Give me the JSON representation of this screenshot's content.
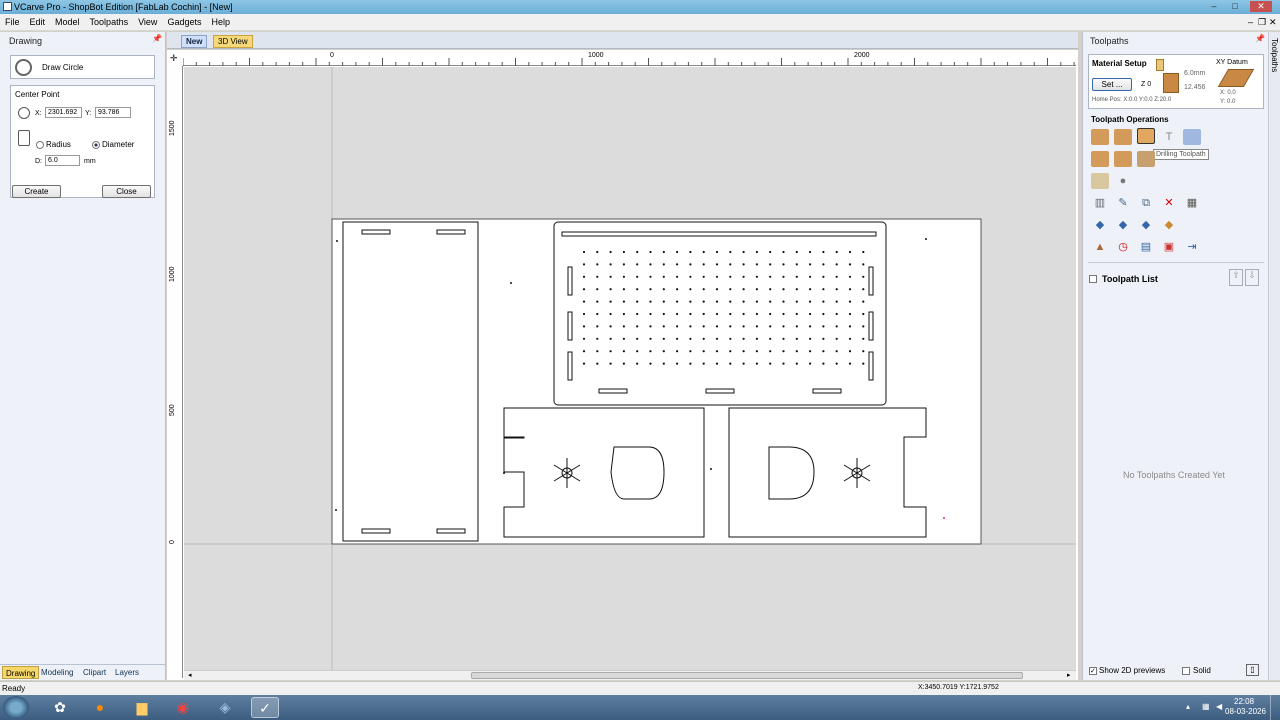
{
  "window": {
    "title": "VCarve Pro - ShopBot Edition [FabLab Cochin] - [New]"
  },
  "menu": [
    "File",
    "Edit",
    "Model",
    "Toolpaths",
    "View",
    "Gadgets",
    "Help"
  ],
  "doc_tabs": {
    "new": "New",
    "view3d": "3D View"
  },
  "left_panel": {
    "header": "Drawing",
    "tool_title": "Draw Circle",
    "center_point_label": "Center Point",
    "x_label": "X:",
    "x_value": "2301.692",
    "y_label": "Y:",
    "y_value": "93.786",
    "radius_label": "Radius",
    "diameter_label": "Diameter",
    "d_label": "D:",
    "d_value": "6.0",
    "unit": "mm",
    "create": "Create",
    "close": "Close"
  },
  "ruler": {
    "h": [
      "0",
      "1000",
      "2000"
    ],
    "v": [
      "1500",
      "1000",
      "500",
      "0"
    ]
  },
  "bottom_tabs": [
    "Drawing",
    "Modeling",
    "Clipart",
    "Layers"
  ],
  "right_panel": {
    "header": "Toolpaths",
    "material_setup": "Material Setup",
    "thickness": "6.0mm",
    "z_label": "Z 0",
    "z_value": "12.456",
    "set_button": "Set ...",
    "xy_datum": "XY Datum",
    "datum_x": "X: 0.0",
    "datum_y": "Y: 0.0",
    "home_pos": "Home Pos:  X:0.0 Y:0.0 Z:20.0",
    "operations": "Toolpath Operations",
    "tooltip": "Drilling Toolpath",
    "list_title": "Toolpath List",
    "empty": "No Toolpaths Created Yet",
    "show_previews": "Show 2D previews",
    "solid": "Solid"
  },
  "far_right_tab": "Toolpaths",
  "status": {
    "left": "Ready",
    "coords": "X:3450.7019 Y:1721.9752"
  },
  "clock": {
    "time": "22:08",
    "date": "08-03-2026"
  }
}
